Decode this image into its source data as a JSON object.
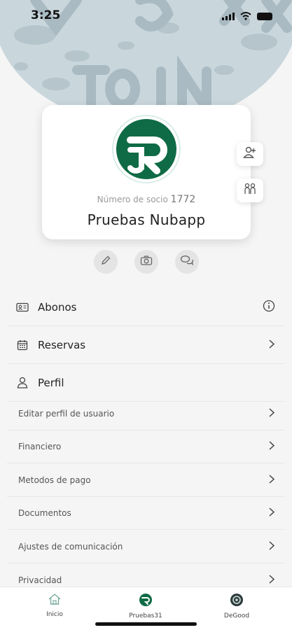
{
  "status_bar": {
    "time": "3:25"
  },
  "profile": {
    "member_label": "Número de socio",
    "member_number": "1772",
    "name": "Pruebas Nubapp"
  },
  "menu": {
    "abonos": "Abonos",
    "reservas": "Reservas",
    "perfil": "Perfil",
    "sub_items": [
      "Editar perfil de usuario",
      "Financiero",
      "Metodos de pago",
      "Documentos",
      "Ajustes de comunicación",
      "Privacidad"
    ]
  },
  "tabbar": {
    "tabs": [
      "Inicio",
      "Pruebas31",
      "DeGood"
    ]
  },
  "colors": {
    "brand": "#0f6b45",
    "background": "#f5f5f5",
    "hero": "#c9d6dc"
  }
}
